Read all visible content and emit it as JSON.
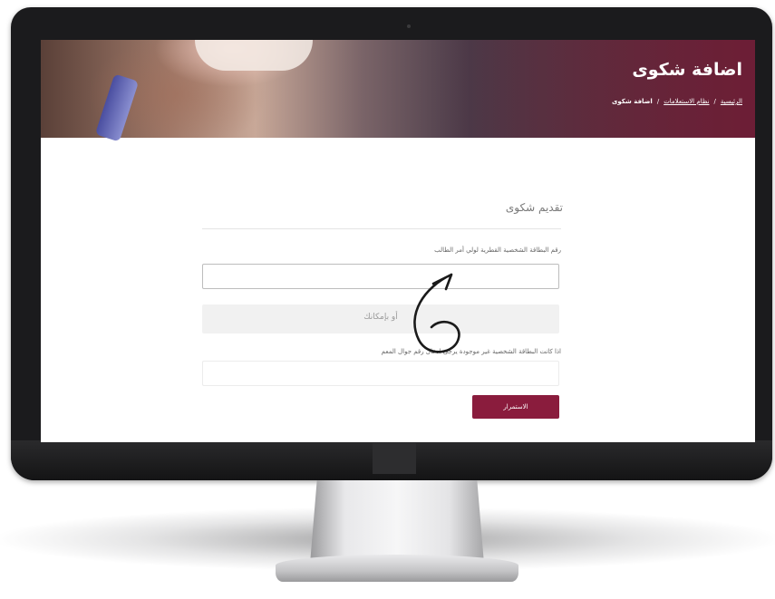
{
  "page": {
    "title": "اضافة شكوى",
    "breadcrumb": {
      "home": "الرئيسية",
      "separator": "/",
      "parent": "نظام الاستعلامات",
      "current": "اضافة شكوى"
    }
  },
  "form": {
    "section_title": "تقديم شكوى",
    "id_label": "رقم البطاقة الشخصية القطرية لولي أمر الطالب",
    "id_value": "",
    "or_text": "أو بإمكانك",
    "mobile_label": "اذا كانت البطاقة الشخصية غير موجودة يرجى ادخال رقم جوال المعم",
    "mobile_value": "",
    "submit_label": "الاستمرار"
  },
  "colors": {
    "accent": "#8a1c3d"
  },
  "icons": [
    "curved-arrow-icon"
  ]
}
